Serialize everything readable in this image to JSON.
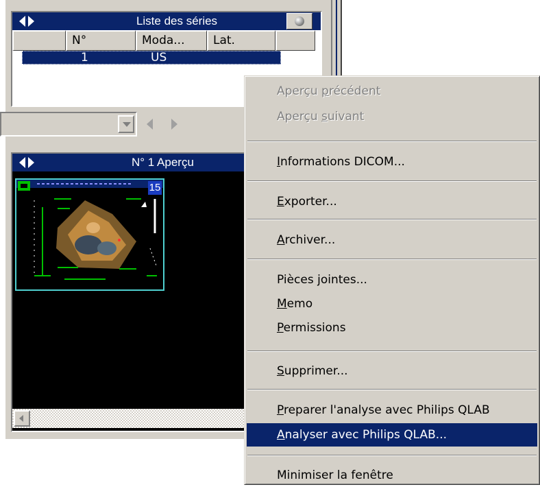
{
  "series_panel": {
    "title": "Liste des séries",
    "columns": [
      "",
      "N°",
      "Moda...",
      "Lat.",
      ""
    ],
    "rows": [
      {
        "num": "1",
        "modality": "US",
        "lat": ""
      }
    ]
  },
  "combo": {
    "value": ""
  },
  "preview_panel": {
    "title": "N° 1 Aperçu",
    "thumb_badge": "15"
  },
  "context_menu": {
    "items": [
      {
        "pre": "Aperçu ",
        "accel": "p",
        "post": "récédent",
        "state": "disabled"
      },
      {
        "pre": "Aperçu ",
        "accel": "s",
        "post": "uivant",
        "state": "disabled"
      },
      {
        "pre": "",
        "accel": "I",
        "post": "nformations DICOM...",
        "state": "normal"
      },
      {
        "pre": "",
        "accel": "E",
        "post": "xporter...",
        "state": "normal"
      },
      {
        "pre": "",
        "accel": "A",
        "post": "rchiver...",
        "state": "normal"
      },
      {
        "pre": "Pièces jointes...",
        "accel": "",
        "post": "",
        "state": "normal"
      },
      {
        "pre": "",
        "accel": "M",
        "post": "emo",
        "state": "normal"
      },
      {
        "pre": "",
        "accel": "P",
        "post": "ermissions",
        "state": "normal"
      },
      {
        "pre": "",
        "accel": "S",
        "post": "upprimer...",
        "state": "normal"
      },
      {
        "pre": "",
        "accel": "P",
        "post": "reparer l'analyse avec Philips QLAB",
        "state": "normal"
      },
      {
        "pre": "",
        "accel": "A",
        "post": "nalyser avec Philips QLAB...",
        "state": "highlighted"
      },
      {
        "pre": "Minimiser la fenêtre",
        "accel": "",
        "post": "",
        "state": "normal"
      }
    ]
  },
  "colors": {
    "title_bar": "#0a246a",
    "face": "#d4d0c8",
    "thumb_border": "#4fd0d0"
  }
}
